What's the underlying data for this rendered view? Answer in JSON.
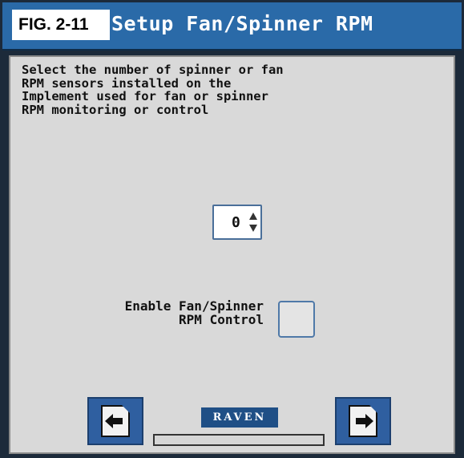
{
  "figure_label": "FIG. 2-11",
  "window": {
    "title": "Setup Fan/Spinner RPM"
  },
  "instructions": "Select the number of spinner or fan\nRPM sensors installed on the\nImplement used for fan or spinner\nRPM monitoring or control",
  "sensor_count": {
    "value": "0"
  },
  "enable_control": {
    "label_line1": "Enable Fan/Spinner",
    "label_line2": "RPM Control",
    "checked": false
  },
  "footer": {
    "logo_text": "RAVEN",
    "progress_fraction": 0
  },
  "icons": {
    "back": "back-page-icon",
    "next": "next-page-icon",
    "spin_up": "arrow-up-icon",
    "spin_down": "arrow-down-icon"
  },
  "colors": {
    "titlebar": "#2a6aa8",
    "panel": "#d9d9d9",
    "button": "#2f5fa0",
    "logo_bg": "#1f4f86"
  }
}
